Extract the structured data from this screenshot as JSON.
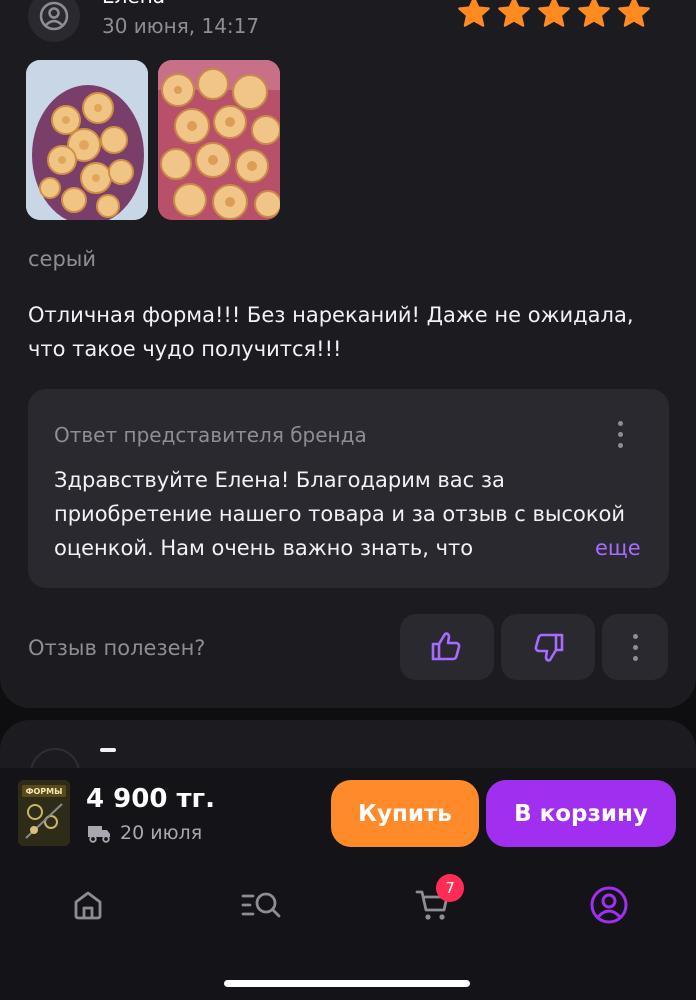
{
  "review": {
    "author": "Елена",
    "date": "30 июня, 14:17",
    "rating": 5,
    "variant": "серый",
    "text": "Отличная форма!!! Без нареканий! Даже не ожидала, что такое чудо получится!!!",
    "brand_reply": {
      "title": "Ответ представителя бренда",
      "text": "Здравствуйте Елена! Благодарим вас за приобретение нашего товара и за отзыв с высокой оценкой. Нам очень важно знать, что",
      "more_label": "еще"
    },
    "helpful_label": "Отзыв полезен?"
  },
  "buy_bar": {
    "price": "4 900 тг.",
    "delivery": "20 июля",
    "buy_label": "Купить",
    "cart_label": "В корзину",
    "thumb_text": "ФОРМЫ"
  },
  "nav": {
    "items": [
      "home",
      "catalog-search",
      "cart",
      "profile"
    ],
    "cart_count": "7",
    "active": "profile"
  },
  "colors": {
    "accent_purple": "#a12ff0",
    "accent_orange": "#ff8a2a",
    "star": "#ff8a1f",
    "badge": "#ff2d55"
  }
}
